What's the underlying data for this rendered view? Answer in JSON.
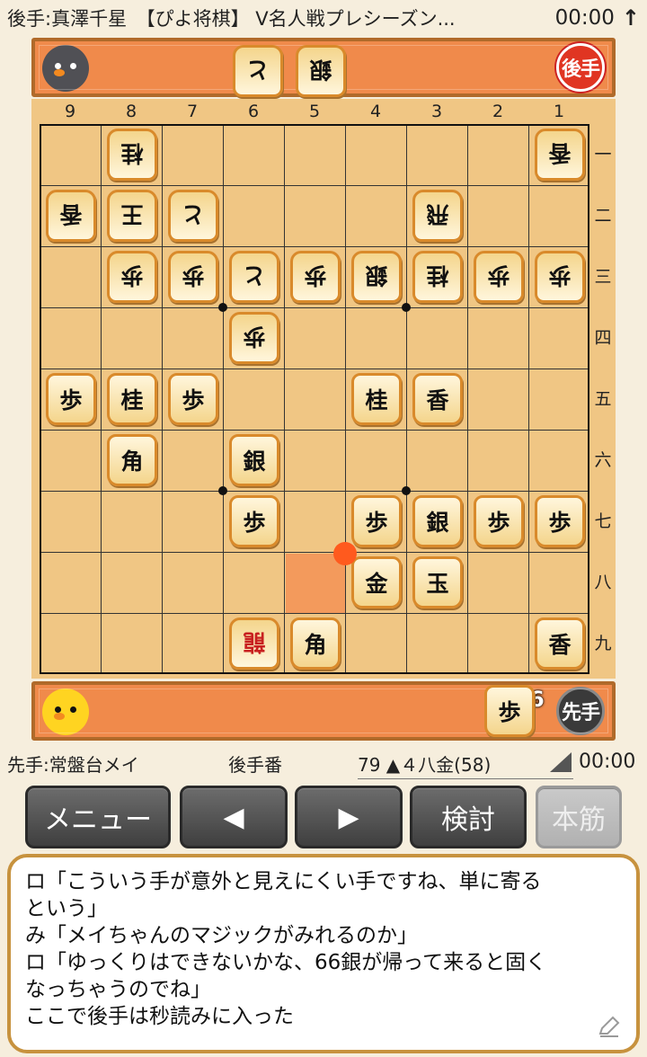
{
  "header": {
    "title": "後手:真澤千星　【ぴよ将棋】 V名人戦プレシーズン...",
    "time": "00:00",
    "arrow_icon": "up-arrow-icon"
  },
  "gote_hand": {
    "badge": "後手",
    "pieces": [
      "と",
      "銀"
    ]
  },
  "sente_hand": {
    "badge": "先手",
    "pieces": [
      {
        "kanji": "歩",
        "count": "6"
      }
    ]
  },
  "board": {
    "files": [
      "9",
      "8",
      "7",
      "6",
      "5",
      "4",
      "3",
      "2",
      "1"
    ],
    "ranks": [
      "一",
      "二",
      "三",
      "四",
      "五",
      "六",
      "七",
      "八",
      "九"
    ],
    "pieces": [
      {
        "f": 8,
        "r": 1,
        "k": "桂",
        "side": "gote"
      },
      {
        "f": 1,
        "r": 1,
        "k": "香",
        "side": "gote"
      },
      {
        "f": 9,
        "r": 2,
        "k": "香",
        "side": "gote"
      },
      {
        "f": 8,
        "r": 2,
        "k": "王",
        "side": "gote"
      },
      {
        "f": 7,
        "r": 2,
        "k": "と",
        "side": "gote"
      },
      {
        "f": 3,
        "r": 2,
        "k": "飛",
        "side": "gote"
      },
      {
        "f": 8,
        "r": 3,
        "k": "歩",
        "side": "gote"
      },
      {
        "f": 7,
        "r": 3,
        "k": "歩",
        "side": "gote"
      },
      {
        "f": 6,
        "r": 3,
        "k": "と",
        "side": "gote"
      },
      {
        "f": 5,
        "r": 3,
        "k": "歩",
        "side": "gote"
      },
      {
        "f": 4,
        "r": 3,
        "k": "銀",
        "side": "gote"
      },
      {
        "f": 3,
        "r": 3,
        "k": "桂",
        "side": "gote"
      },
      {
        "f": 2,
        "r": 3,
        "k": "歩",
        "side": "gote"
      },
      {
        "f": 1,
        "r": 3,
        "k": "歩",
        "side": "gote"
      },
      {
        "f": 6,
        "r": 4,
        "k": "歩",
        "side": "gote"
      },
      {
        "f": 9,
        "r": 5,
        "k": "歩",
        "side": "sente"
      },
      {
        "f": 8,
        "r": 5,
        "k": "桂",
        "side": "sente"
      },
      {
        "f": 7,
        "r": 5,
        "k": "歩",
        "side": "sente"
      },
      {
        "f": 4,
        "r": 5,
        "k": "桂",
        "side": "sente"
      },
      {
        "f": 3,
        "r": 5,
        "k": "香",
        "side": "sente"
      },
      {
        "f": 8,
        "r": 6,
        "k": "角",
        "side": "sente"
      },
      {
        "f": 6,
        "r": 6,
        "k": "銀",
        "side": "sente"
      },
      {
        "f": 6,
        "r": 7,
        "k": "歩",
        "side": "sente"
      },
      {
        "f": 4,
        "r": 7,
        "k": "歩",
        "side": "sente"
      },
      {
        "f": 3,
        "r": 7,
        "k": "銀",
        "side": "sente"
      },
      {
        "f": 2,
        "r": 7,
        "k": "歩",
        "side": "sente"
      },
      {
        "f": 1,
        "r": 7,
        "k": "歩",
        "side": "sente"
      },
      {
        "f": 4,
        "r": 8,
        "k": "金",
        "side": "sente"
      },
      {
        "f": 3,
        "r": 8,
        "k": "玉",
        "side": "sente"
      },
      {
        "f": 6,
        "r": 9,
        "k": "龍",
        "side": "gote",
        "promoted": true
      },
      {
        "f": 5,
        "r": 9,
        "k": "角",
        "side": "sente"
      },
      {
        "f": 1,
        "r": 9,
        "k": "香",
        "side": "sente"
      }
    ],
    "last_move_from": {
      "f": 5,
      "r": 8
    },
    "last_move_to": {
      "f": 4,
      "r": 8
    }
  },
  "status": {
    "sente_name": "先手:常盤台メイ",
    "turn": "後手番",
    "move": "79 ▲４八金(58)",
    "time": "00:00"
  },
  "buttons": {
    "menu": "メニュー",
    "prev": "◀",
    "next": "▶",
    "review": "検討",
    "main_line": "本筋"
  },
  "comment": {
    "lines": [
      "ロ「こういう手が意外と見えにくい手ですね、単に寄る\nという」",
      "み「メイちゃんのマジックがみれるのか」",
      "ロ「ゆっくりはできないかな、66銀が帰って来ると固く\nなっちゃうのでね」",
      "ここで後手は秒読みに入った"
    ],
    "edit_icon": "pencil-icon"
  },
  "colors": {
    "hand_bg": "#f08a4b",
    "board_bg": "#f0c684",
    "piece_border": "#d98a2b",
    "promoted_text": "#c82020",
    "last_move_dot": "#ff5a1e"
  }
}
